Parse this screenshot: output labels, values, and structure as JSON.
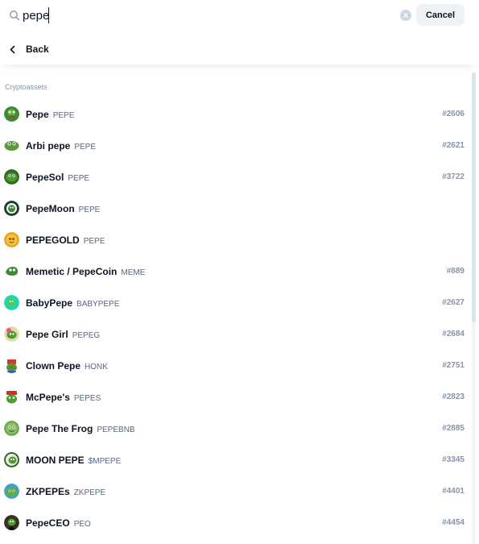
{
  "search": {
    "query": "pepe",
    "placeholder": "Search",
    "cancel_label": "Cancel"
  },
  "nav": {
    "back_label": "Back"
  },
  "results": {
    "section_title": "Cryptoassets",
    "items": [
      {
        "name": "Pepe",
        "symbol": "PEPE",
        "rank": "#2606",
        "icon": "pepe-logo-icon"
      },
      {
        "name": "Arbi pepe",
        "symbol": "PEPE",
        "rank": "#2621",
        "icon": "arbi-pepe-logo-icon"
      },
      {
        "name": "PepeSol",
        "symbol": "PEPE",
        "rank": "#3722",
        "icon": "pepesol-logo-icon"
      },
      {
        "name": "PepeMoon",
        "symbol": "PEPE",
        "rank": "",
        "icon": "pepemoon-logo-icon"
      },
      {
        "name": "PEPEGOLD",
        "symbol": "PEPE",
        "rank": "",
        "icon": "pepegold-logo-icon"
      },
      {
        "name": "Memetic / PepeCoin",
        "symbol": "MEME",
        "rank": "#889",
        "icon": "memetic-logo-icon"
      },
      {
        "name": "BabyPepe",
        "symbol": "BABYPEPE",
        "rank": "#2627",
        "icon": "babypepe-logo-icon"
      },
      {
        "name": "Pepe Girl",
        "symbol": "PEPEG",
        "rank": "#2684",
        "icon": "pepe-girl-logo-icon"
      },
      {
        "name": "Clown Pepe",
        "symbol": "HONK",
        "rank": "#2751",
        "icon": "clown-pepe-logo-icon"
      },
      {
        "name": "McPepe's",
        "symbol": "PEPES",
        "rank": "#2823",
        "icon": "mcpepes-logo-icon"
      },
      {
        "name": "Pepe The Frog",
        "symbol": "PEPEBNB",
        "rank": "#2885",
        "icon": "pepe-the-frog-logo-icon"
      },
      {
        "name": "MOON PEPE",
        "symbol": "$MPEPE",
        "rank": "#3345",
        "icon": "moon-pepe-logo-icon"
      },
      {
        "name": "ZKPEPEs",
        "symbol": "ZKPEPE",
        "rank": "#4401",
        "icon": "zkpepes-logo-icon"
      },
      {
        "name": "PepeCEO",
        "symbol": "PEO",
        "rank": "#4454",
        "icon": "pepeceo-logo-icon"
      }
    ]
  },
  "colors": {
    "text_primary": "#0d1421",
    "text_secondary": "#58667e",
    "text_muted": "#8a94a8",
    "button_bg": "#eff2f5",
    "frog_green": "#4e9a33",
    "gold": "#e8a524",
    "teal": "#1fd8a8"
  }
}
